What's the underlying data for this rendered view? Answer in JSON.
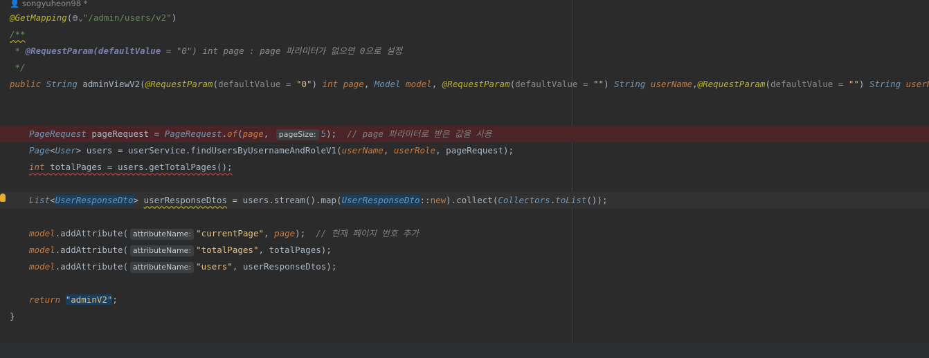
{
  "author": "songyuheon98 *",
  "lines": {
    "mapping_annotation": "@GetMapping",
    "mapping_path": "\"/admin/users/v2\"",
    "doc_open": "/**",
    "doc_line_tag": "@RequestParam(defaultValue",
    "doc_line_rest": " = \"0\") int page : page 파라미터가 없으면 0으로 설정",
    "doc_close": " */",
    "sig_public": "public",
    "sig_string": "String",
    "sig_method": "adminViewV2",
    "sig_rp1": "@RequestParam",
    "sig_dv1": "defaultValue = ",
    "sig_zero": "\"0\"",
    "sig_int": "int",
    "sig_page": "page",
    "sig_model_type": "Model",
    "sig_model": "model",
    "sig_rp2": "@RequestParam",
    "sig_dv2": "defaultValue = ",
    "sig_empty": "\"\"",
    "sig_string2": "String",
    "sig_userName": "userName",
    "sig_rp3": "@RequestParam",
    "sig_dv3": "defaultValue = ",
    "sig_empty2": "\"\"",
    "sig_string3": "String",
    "sig_userRole": "userRole",
    "sig_end": " ) {",
    "pr_type": "PageRequest",
    "pr_var": "pageRequest",
    "pr_cls": "PageRequest",
    "pr_of": "of",
    "pr_page": "page",
    "pr_hint": "pageSize:",
    "pr_five": "5",
    "pr_comment": "// page 파라미터로 받은 값을 사용",
    "pg_type": "Page",
    "pg_user": "User",
    "pg_var": "users",
    "pg_svc": "userService",
    "pg_method": "findUsersByUsernameAndRoleV1",
    "pg_a1": "userName",
    "pg_a2": "userRole",
    "pg_a3": "pageRequest",
    "tp_int": "int",
    "tp_var": "totalPages",
    "tp_users": "users",
    "tp_method": "getTotalPages",
    "ls_type": "List",
    "ls_dto": "UserResponseDto",
    "ls_var": "userResponseDtos",
    "ls_users": "users",
    "ls_stream": "stream",
    "ls_map": "map",
    "ls_dto2": "UserResponseDto",
    "ls_new": "new",
    "ls_collect": "collect",
    "ls_collectors": "Collectors",
    "ls_tolist": "toList",
    "ma_model": "model",
    "ma_method": "addAttribute",
    "ma_hint": "attributeName:",
    "ma1_str": "\"currentPage\"",
    "ma1_arg": "page",
    "ma1_comment": "// 현재 페이지 번호 추가",
    "ma2_str": "\"totalPages\"",
    "ma2_arg": "totalPages",
    "ma3_str": "\"users\"",
    "ma3_arg": "userResponseDtos",
    "ret_kw": "return",
    "ret_str": "\"adminV2\"",
    "close_brace": "}"
  }
}
